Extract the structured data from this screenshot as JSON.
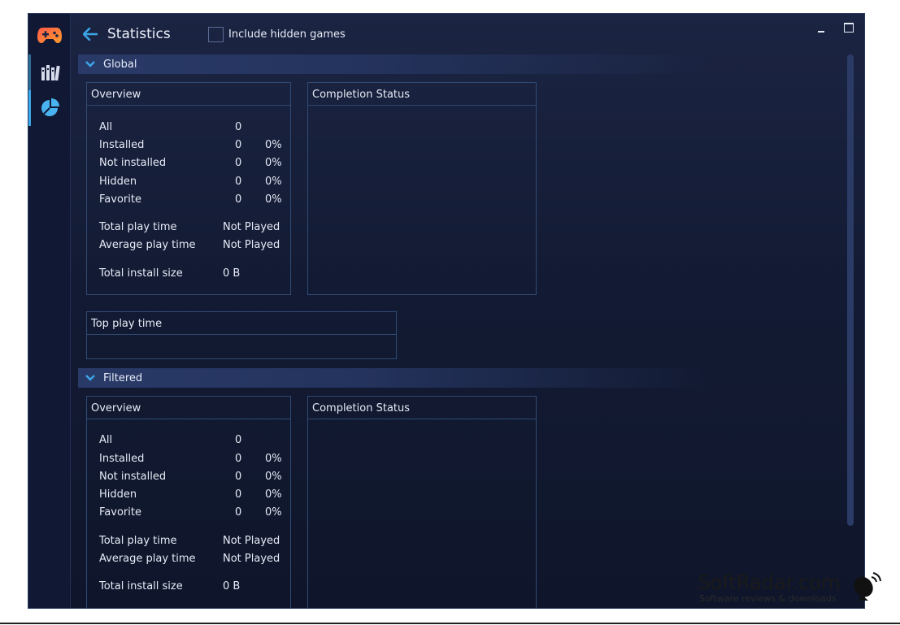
{
  "app": {
    "logo_icon": "gamepad-icon",
    "sidebar": [
      {
        "icon": "library-icon",
        "label": "Library"
      },
      {
        "icon": "statistics-icon",
        "label": "Statistics"
      }
    ]
  },
  "header": {
    "title": "Statistics",
    "include_hidden_label": "Include hidden games",
    "include_hidden_checked": false
  },
  "sections": {
    "global": {
      "label": "Global",
      "overview": {
        "title": "Overview",
        "rows": [
          {
            "label": "All",
            "count": "0",
            "pct": ""
          },
          {
            "label": "Installed",
            "count": "0",
            "pct": "0%"
          },
          {
            "label": "Not installed",
            "count": "0",
            "pct": "0%"
          },
          {
            "label": "Hidden",
            "count": "0",
            "pct": "0%"
          },
          {
            "label": "Favorite",
            "count": "0",
            "pct": "0%"
          }
        ],
        "total_play_time_label": "Total play time",
        "total_play_time": "Not Played",
        "avg_play_time_label": "Average play time",
        "avg_play_time": "Not Played",
        "total_install_size_label": "Total install size",
        "total_install_size": "0 B"
      },
      "completion_title": "Completion Status",
      "top_play_time_title": "Top play time"
    },
    "filtered": {
      "label": "Filtered",
      "overview": {
        "title": "Overview",
        "rows": [
          {
            "label": "All",
            "count": "0",
            "pct": ""
          },
          {
            "label": "Installed",
            "count": "0",
            "pct": "0%"
          },
          {
            "label": "Not installed",
            "count": "0",
            "pct": "0%"
          },
          {
            "label": "Hidden",
            "count": "0",
            "pct": "0%"
          },
          {
            "label": "Favorite",
            "count": "0",
            "pct": "0%"
          }
        ],
        "total_play_time_label": "Total play time",
        "total_play_time": "Not Played",
        "avg_play_time_label": "Average play time",
        "avg_play_time": "Not Played",
        "total_install_size_label": "Total install size",
        "total_install_size": "0 B"
      },
      "completion_title": "Completion Status"
    }
  },
  "watermark": {
    "title": "SoftRadar.com",
    "subtitle": "Software reviews & downloads"
  },
  "colors": {
    "accent": "#3aa6e8",
    "window_bg": "#141c36",
    "panel_border": "#2f4a74"
  }
}
